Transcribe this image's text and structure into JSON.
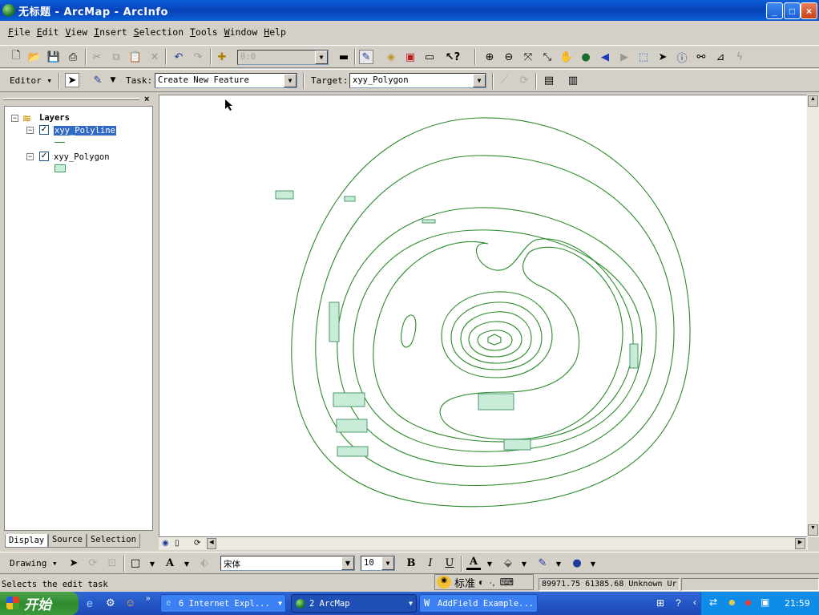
{
  "window": {
    "title": "无标题 - ArcMap - ArcInfo",
    "min": "_",
    "max": "□",
    "close": "×"
  },
  "menu": [
    "File",
    "Edit",
    "View",
    "Insert",
    "Selection",
    "Tools",
    "Window",
    "Help"
  ],
  "standard_toolbar": {
    "scale_value": "0:0"
  },
  "editor_toolbar": {
    "editor_label": "Editor",
    "task_label": "Task:",
    "task_value": "Create New Feature",
    "target_label": "Target:",
    "target_value": "xyy_Polygon"
  },
  "toc": {
    "root_label": "Layers",
    "layers": [
      {
        "name": "xyy_Polyline",
        "checked": true,
        "selected": true
      },
      {
        "name": "xyy_Polygon",
        "checked": true,
        "selected": false
      }
    ],
    "tabs": [
      "Display",
      "Source",
      "Selection"
    ]
  },
  "map": {
    "line_color": "#2a8a2a",
    "fill_color": "#c8ecd8",
    "stroke_color": "#4a9a6a"
  },
  "drawing_toolbar": {
    "drawing_label": "Drawing",
    "font_name": "宋体",
    "font_size": "10",
    "bold": "B",
    "italic": "I",
    "underline": "U"
  },
  "ime": {
    "label": "标准"
  },
  "status": {
    "message": "Selects the edit task",
    "coords": "89971.75  61385.68 Unknown Ur"
  },
  "taskbar": {
    "start_label": "开始",
    "tasks": [
      {
        "label": "6 Internet Expl...",
        "active": false
      },
      {
        "label": "2 ArcMap",
        "active": true
      },
      {
        "label": "AddField Example...",
        "active": false
      }
    ],
    "clock": "21:59"
  }
}
